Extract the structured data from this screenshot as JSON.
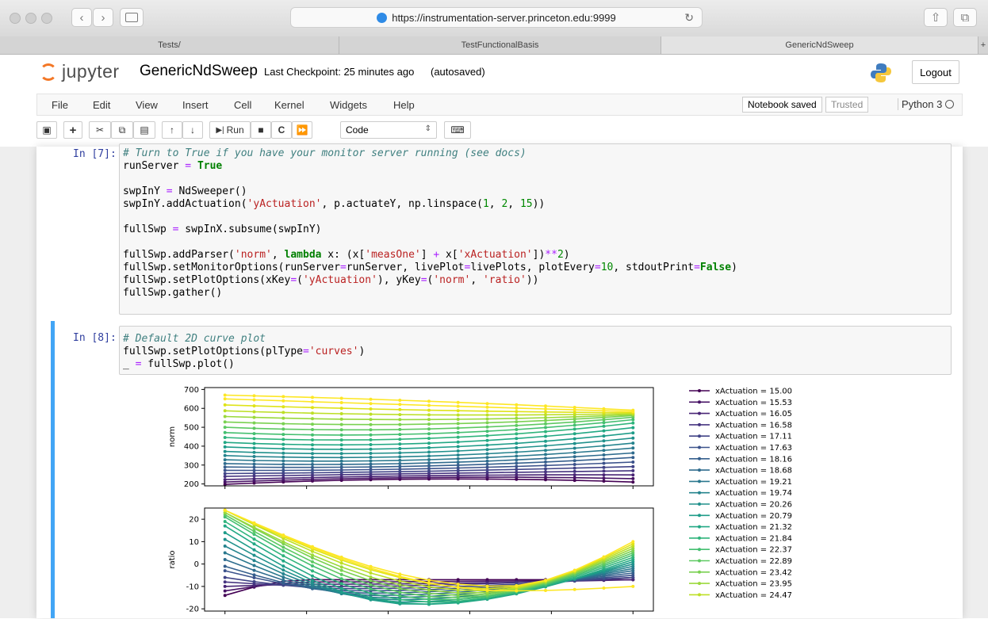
{
  "browser": {
    "url": "https://instrumentation-server.princeton.edu:9999",
    "tabs": [
      "Tests/",
      "TestFunctionalBasis",
      "GenericNdSweep"
    ],
    "new_tab_label": "+"
  },
  "header": {
    "logo_text": "jupyter",
    "notebook_name": "GenericNdSweep",
    "checkpoint": "Last Checkpoint: 25 minutes ago",
    "autosave": "(autosaved)",
    "logout": "Logout"
  },
  "menubar": {
    "items": [
      "File",
      "Edit",
      "View",
      "Insert",
      "Cell",
      "Kernel",
      "Widgets",
      "Help"
    ],
    "notebook_saved": "Notebook saved",
    "trusted": "Trusted",
    "kernel": "Python 3"
  },
  "toolbar": {
    "run_label": "Run",
    "cell_type": "Code"
  },
  "cells": [
    {
      "prompt": "In [7]:",
      "lines": [
        "# Turn to True if you have your monitor server running (see docs)",
        "runServer = True",
        "",
        "swpInY = NdSweeper()",
        "swpInY.addActuation('yActuation', p.actuateY, np.linspace(1, 2, 15))",
        "",
        "fullSwp = swpInX.subsume(swpInY)",
        "",
        "fullSwp.addParser('norm', lambda x: (x['measOne'] + x['xActuation'])**2)",
        "fullSwp.setMonitorOptions(runServer=runServer, livePlot=livePlots, plotEvery=10, stdoutPrint=False)",
        "fullSwp.setPlotOptions(xKey=('yActuation'), yKey=('norm', 'ratio'))",
        "fullSwp.gather()"
      ]
    },
    {
      "prompt": "In [8]:",
      "lines": [
        "# Default 2D curve plot",
        "fullSwp.setPlotOptions(plType='curves')",
        "_ = fullSwp.plot()"
      ]
    }
  ],
  "chart_data": [
    {
      "type": "line",
      "ylabel": "norm",
      "ylim": [
        190,
        710
      ],
      "yticks": [
        200,
        300,
        400,
        500,
        600,
        700
      ],
      "x": [
        1.0,
        1.0714,
        1.1429,
        1.2143,
        1.2857,
        1.3571,
        1.4286,
        1.5,
        1.5714,
        1.6429,
        1.7143,
        1.7857,
        1.8571,
        1.9286,
        2.0
      ],
      "series_start_values": [
        198,
        210,
        223,
        240,
        255,
        272,
        290,
        308,
        328,
        350,
        372,
        396,
        420,
        446,
        472,
        500,
        528,
        557,
        587,
        618,
        650,
        670
      ],
      "series_end_values": [
        210,
        228,
        248,
        270,
        292,
        316,
        340,
        364,
        390,
        416,
        443,
        470,
        498,
        522,
        540,
        553,
        562,
        567,
        572,
        577,
        583,
        590
      ],
      "series_mid_values": [
        248,
        250,
        252,
        256,
        262,
        268,
        276,
        286,
        298,
        312,
        330,
        350,
        372,
        398,
        426,
        456,
        488,
        520,
        552,
        583,
        615,
        645
      ],
      "grid": false
    },
    {
      "type": "line",
      "ylabel": "ratio",
      "ylim": [
        -21,
        25
      ],
      "yticks": [
        -20,
        -10,
        0,
        10,
        20
      ],
      "x": [
        1.0,
        1.0714,
        1.1429,
        1.2143,
        1.2857,
        1.3571,
        1.4286,
        1.5,
        1.5714,
        1.6429,
        1.7143,
        1.7857,
        1.8571,
        1.9286,
        2.0
      ],
      "series_start_values": [
        -14,
        -12,
        -10,
        -8,
        -6,
        -3,
        -1,
        2,
        5,
        8,
        11,
        14,
        17,
        19,
        21,
        22,
        23,
        23,
        24,
        24,
        24,
        24
      ],
      "series_end_values": [
        -7,
        -7,
        -7,
        -6,
        -6,
        -5,
        -4,
        -3,
        -2,
        -1,
        0,
        1,
        2,
        3,
        4,
        5,
        6,
        7,
        8,
        9,
        10,
        -10
      ],
      "series_min_values": [
        -7,
        -8,
        -9,
        -10,
        -11,
        -12,
        -13,
        -14,
        -15,
        -16,
        -17,
        -18,
        -18,
        -17,
        -16,
        -15,
        -14,
        -13,
        -12,
        -11,
        -10,
        -12
      ],
      "grid": false
    }
  ],
  "legend": [
    "xActuation = 15.00",
    "xActuation = 15.53",
    "xActuation = 16.05",
    "xActuation = 16.58",
    "xActuation = 17.11",
    "xActuation = 17.63",
    "xActuation = 18.16",
    "xActuation = 18.68",
    "xActuation = 19.21",
    "xActuation = 19.74",
    "xActuation = 20.26",
    "xActuation = 20.79",
    "xActuation = 21.32",
    "xActuation = 21.84",
    "xActuation = 22.37",
    "xActuation = 22.89",
    "xActuation = 23.42",
    "xActuation = 23.95",
    "xActuation = 24.47"
  ],
  "colors": {
    "viridis": [
      "#440154",
      "#471365",
      "#482475",
      "#463480",
      "#414487",
      "#3b528b",
      "#355f8d",
      "#2f6c8e",
      "#2a788e",
      "#25848e",
      "#21918c",
      "#1e9c89",
      "#22a884",
      "#2fb47c",
      "#44bf70",
      "#5ec962",
      "#7ad151",
      "#9bd93c",
      "#bddf26",
      "#dfe318",
      "#fde725",
      "#fde725"
    ],
    "selected_bar": "#42a5f5",
    "prompt": "#303f9f"
  }
}
